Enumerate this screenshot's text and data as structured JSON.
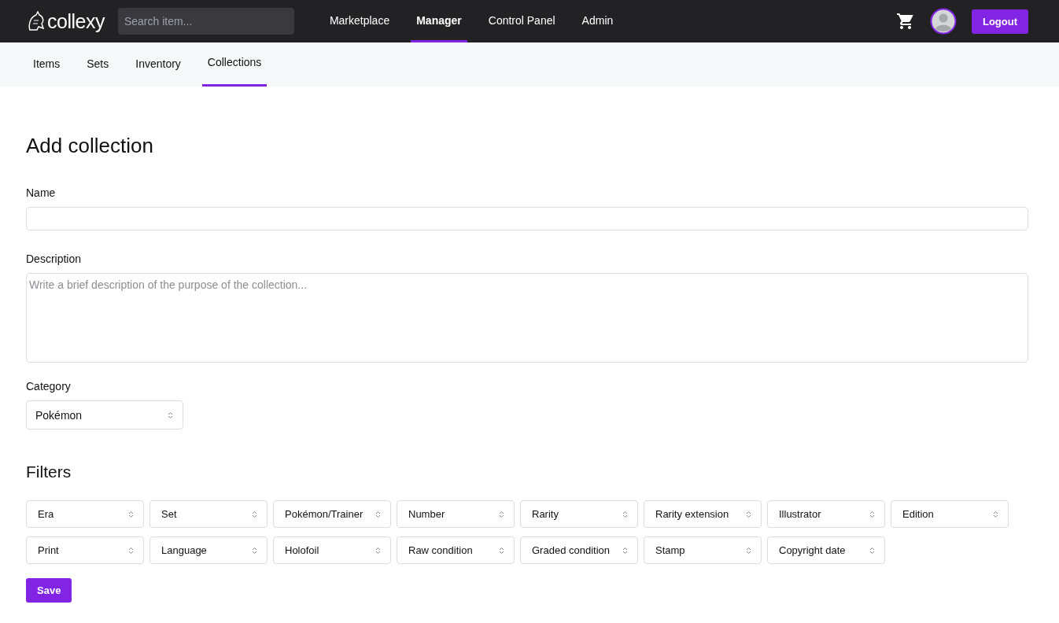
{
  "header": {
    "logo": "collexy",
    "search": {
      "placeholder": "Search item..."
    },
    "nav": [
      {
        "label": "Marketplace",
        "selected": false
      },
      {
        "label": "Manager",
        "selected": true
      },
      {
        "label": "Control Panel",
        "selected": false
      },
      {
        "label": "Admin",
        "selected": false
      }
    ],
    "logout": "Logout"
  },
  "subnav": [
    {
      "label": "Items",
      "selected": false
    },
    {
      "label": "Sets",
      "selected": false
    },
    {
      "label": "Inventory",
      "selected": false
    },
    {
      "label": "Collections",
      "selected": true
    }
  ],
  "form": {
    "title": "Add collection",
    "name": {
      "label": "Name"
    },
    "description": {
      "label": "Description",
      "placeholder": "Write a brief description of the purpose of the collection..."
    },
    "category": {
      "label": "Category",
      "value": "Pokémon"
    },
    "filters_title": "Filters",
    "filters": [
      "Era",
      "Set",
      "Pokémon/Trainer",
      "Number",
      "Rarity",
      "Rarity extension",
      "Illustrator",
      "Edition",
      "Print",
      "Language",
      "Holofoil",
      "Raw condition",
      "Graded condition",
      "Stamp",
      "Copyright date"
    ],
    "save": "Save"
  }
}
